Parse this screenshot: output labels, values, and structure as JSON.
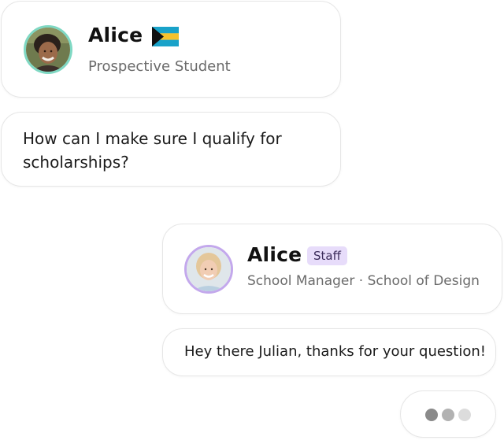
{
  "student": {
    "name": "Alice",
    "role": "Prospective Student",
    "flag_icon": "bahamas-flag-icon",
    "avatar_ring_color": "#7fd8c3"
  },
  "question": {
    "text": "How can I make sure I qualify for scholarships?"
  },
  "staff": {
    "name": "Alice",
    "badge": "Staff",
    "role": "School Manager · School of Design",
    "avatar_ring_color": "#c3a8ec",
    "badge_color": "#e7dcfa"
  },
  "reply": {
    "text": "Hey there Julian, thanks for your question!"
  },
  "typing_indicator": {
    "dots": 3
  }
}
